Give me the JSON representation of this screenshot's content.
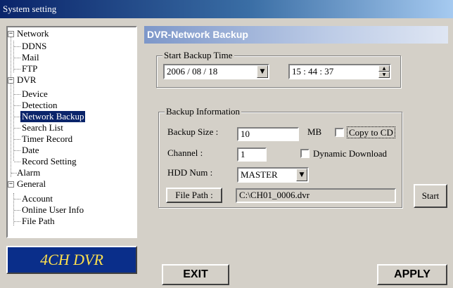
{
  "window": {
    "title": "System setting"
  },
  "tree": {
    "network": {
      "label": "Network",
      "expander": "−",
      "children": [
        "DDNS",
        "Mail",
        "FTP"
      ]
    },
    "dvr": {
      "label": "DVR",
      "expander": "−",
      "children": [
        "Device",
        "Detection",
        "Network Backup",
        "Search List",
        "Timer Record",
        "Date",
        "Record Setting"
      ],
      "selected": "Network Backup"
    },
    "alarm": {
      "label": "Alarm"
    },
    "general": {
      "label": "General",
      "expander": "−",
      "children": [
        "Account",
        "Online User Info",
        "File Path"
      ]
    }
  },
  "brand": {
    "label": "4CH DVR"
  },
  "panel": {
    "title": "DVR-Network Backup",
    "start_backup": {
      "legend": "Start Backup Time",
      "date": "2006 / 08 / 18",
      "time": "15 : 44 : 37",
      "dropdown_arrow": "▼",
      "spin_up": "▲",
      "spin_down": "▼"
    },
    "backup_info": {
      "legend": "Backup Information",
      "size_label": "Backup Size :",
      "size_value": "10",
      "size_unit": "MB",
      "copy_to_cd": "Copy to CD",
      "channel_label": "Channel :",
      "channel_value": "1",
      "dynamic_download": "Dynamic Download",
      "hdd_label": "HDD Num :",
      "hdd_value": "MASTER",
      "dropdown_arrow": "▼",
      "file_path_button": "File Path :",
      "file_path_value": "C:\\CH01_0006.dvr"
    },
    "start_button": "Start"
  },
  "footer": {
    "exit_button": "EXIT",
    "apply_button": "APPLY"
  },
  "colors": {
    "titlebar": "#0a246a",
    "brand_bg": "#0a2e8a",
    "brand_text": "#ffe14d",
    "selection": "#0a246a",
    "face": "#d4d0c8"
  }
}
